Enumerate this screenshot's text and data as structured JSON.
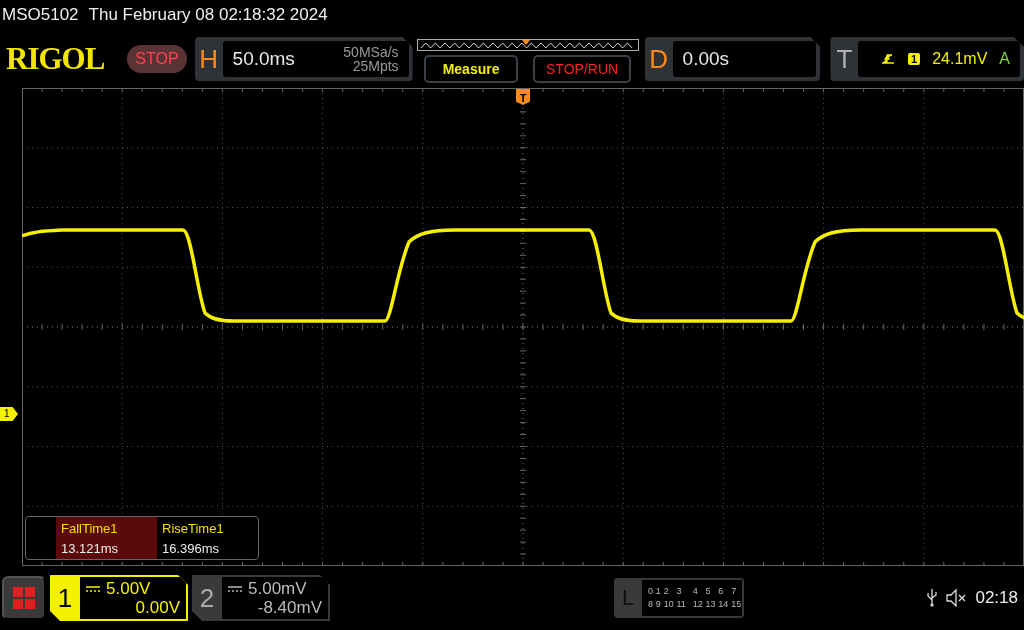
{
  "title_bar": {
    "model": "MSO5102",
    "datetime": "Thu February 08 02:18:32 2024"
  },
  "logo": "RIGOL",
  "run_state": "STOP",
  "horizontal": {
    "label": "H",
    "scale": "50.0ms",
    "sample_rate": "50MSa/s",
    "memory_depth": "25Mpts"
  },
  "buttons": [
    {
      "label": "Measure",
      "kind": "measure"
    },
    {
      "label": "STOP/RUN",
      "kind": "stoprun"
    }
  ],
  "delay": {
    "label": "D",
    "value": "0.00s"
  },
  "trigger": {
    "label": "T",
    "source": "1",
    "level": "24.1mV",
    "mode": "A"
  },
  "trigger_position_marker": "T",
  "channel_marker": "1",
  "measurements": [
    {
      "name": "FallTime1",
      "value": "13.121ms",
      "selected": true
    },
    {
      "name": "RiseTime1",
      "value": "16.396ms",
      "selected": false
    }
  ],
  "channels": [
    {
      "number": "1",
      "scale": "5.00V",
      "offset": "0.00V",
      "selected": true
    },
    {
      "number": "2",
      "scale": "5.00mV",
      "offset": "-8.40mV",
      "selected": false
    }
  ],
  "logic": {
    "label": "L",
    "digital_channels": [
      "0",
      "1",
      "2",
      "3",
      "4",
      "5",
      "6",
      "7",
      "8",
      "9",
      "10",
      "11",
      "12",
      "13",
      "14",
      "15"
    ]
  },
  "status": {
    "time": "02:18"
  }
}
